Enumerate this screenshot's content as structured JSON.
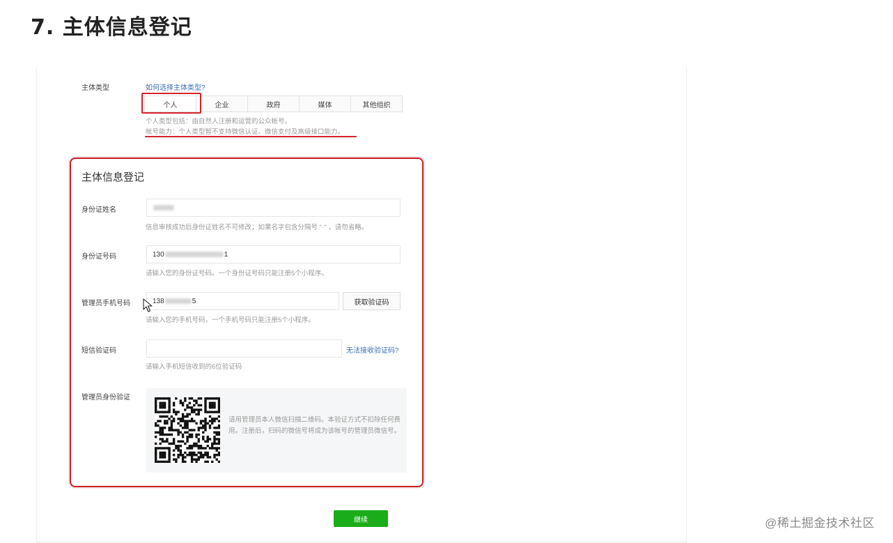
{
  "article": {
    "heading": "7. 主体信息登记"
  },
  "subject_type": {
    "label": "主体类型",
    "help_link": "如何选择主体类型?",
    "tabs": [
      "个人",
      "企业",
      "政府",
      "媒体",
      "其他组织"
    ],
    "selected": "个人",
    "desc_line1": "个人类型包括：由自然人注册和运营的公众帐号。",
    "desc_line2": "帐号能力：个人类型暂不支持微信认证、微信支付及高级接口能力。"
  },
  "registration": {
    "title": "主体信息登记",
    "id_name": {
      "label": "身份证姓名",
      "hint": "信息审核成功后身份证姓名不可修改；如果名字包含分隔号 \"·\" ，请勿省略。"
    },
    "id_number": {
      "label": "身份证号码",
      "value_prefix": "130",
      "value_suffix": "1",
      "hint": "请输入您的身份证号码。一个身份证号码只能注册5个小程序。"
    },
    "phone": {
      "label": "管理员手机号码",
      "value_prefix": "138",
      "value_suffix": "5",
      "get_code_button": "获取验证码",
      "hint": "请输入您的手机号码，一个手机号码只能注册5个小程序。"
    },
    "sms_code": {
      "label": "短信验证码",
      "cant_receive_link": "无法接收验证码?",
      "hint": "请输入手机短信收到的6位验证码"
    },
    "admin_verify": {
      "label": "管理员身份验证",
      "qr_desc": "请用管理员本人微信扫描二维码。本验证方式不扣除任何费用。注册后，扫码的微信号将成为该帐号的管理员微信号。"
    }
  },
  "continue_button": "继续",
  "watermark": "@稀土掘金技术社区",
  "colors": {
    "primary_green": "#1aad19",
    "highlight_red": "#d2232a",
    "link_blue": "#3b6fb5"
  }
}
